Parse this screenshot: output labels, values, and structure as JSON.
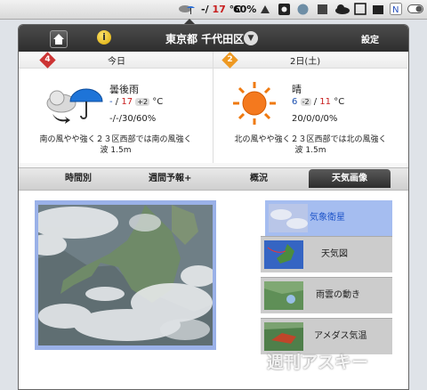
{
  "menubar": {
    "temp_sep": "-/",
    "temp_hi": "17",
    "temp_unit": "°C",
    "battery": "60%"
  },
  "panel": {
    "location": "東京都 千代田区",
    "settings_label": "設定"
  },
  "today": {
    "rank": "4",
    "rank_color": "#cc3333",
    "label": "今日",
    "condition": "曇後雨",
    "temp_lo": "-",
    "temp_sep": "/",
    "temp_hi": "17",
    "temp_delta": "+2",
    "temp_unit": "°C",
    "rain": "-/-/30/60%",
    "wind": "南の風やや強く２３区西部では南の風強く",
    "wave": "波 1.5m"
  },
  "tomorrow": {
    "rank": "2",
    "rank_color": "#ee9922",
    "label": "2日(土)",
    "condition": "晴",
    "temp_lo": "6",
    "temp_lo_delta": "-2",
    "temp_sep": "/",
    "temp_hi": "11",
    "temp_unit": "°C",
    "rain": "20/0/0/0%",
    "wind": "北の風やや強く２３区西部では北の風強く",
    "wave": "波 1.5m"
  },
  "tabs": [
    "時間別",
    "週間予報+",
    "概況",
    "天気画像"
  ],
  "thumbnails": [
    "気象衛星",
    "天気図",
    "雨雲の動き",
    "アメダス気温"
  ],
  "watermark": "週刊アスキー",
  "colors": {
    "accent_blue": "#1f55c9",
    "temp_red": "#c81e1e",
    "temp_blue": "#1b4fb0",
    "selected_row": "#a5bdf0"
  }
}
